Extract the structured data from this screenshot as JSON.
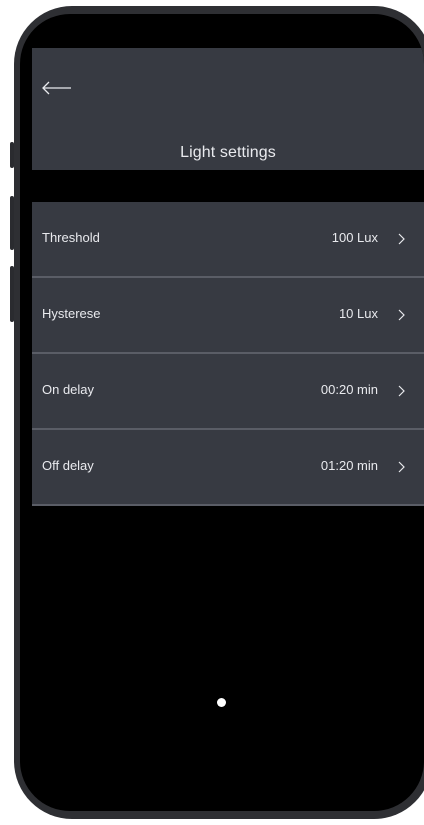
{
  "header": {
    "back_icon": "arrow-left-icon",
    "title": "Light settings"
  },
  "settings": [
    {
      "label": "Threshold",
      "value": "100 Lux",
      "icon": "chevron-right-icon"
    },
    {
      "label": "Hysterese",
      "value": "10 Lux",
      "icon": "chevron-right-icon"
    },
    {
      "label": "On delay",
      "value": "00:20 min",
      "icon": "chevron-right-icon"
    },
    {
      "label": "Off delay",
      "value": "01:20 min",
      "icon": "chevron-right-icon"
    }
  ],
  "colors": {
    "panel": "#373a42",
    "screen_background": "#000000",
    "text": "#e9eaee",
    "divider": "#5a5d66"
  }
}
